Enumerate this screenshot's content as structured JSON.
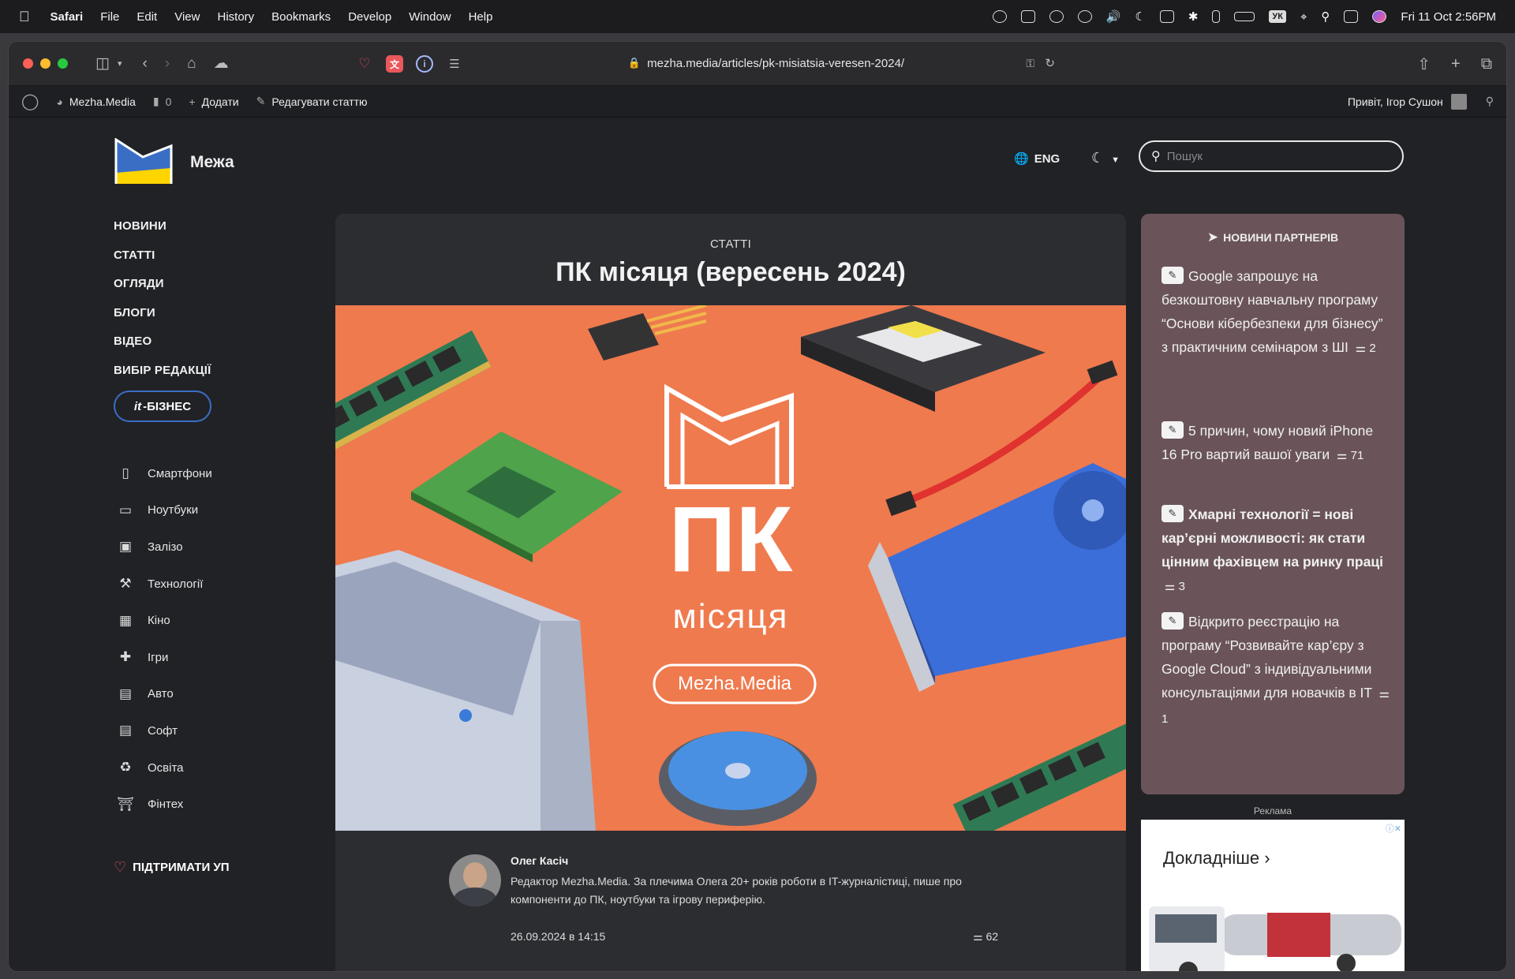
{
  "menubar": {
    "app": "Safari",
    "items": [
      "File",
      "Edit",
      "View",
      "History",
      "Bookmarks",
      "Develop",
      "Window",
      "Help"
    ],
    "vk": "УК",
    "clock": "Fri 11 Oct  2:56PM"
  },
  "browser": {
    "url": "mezha.media/articles/pk-misiatsia-veresen-2024/"
  },
  "wpbar": {
    "site": "Mezha.Media",
    "comments": "0",
    "add": "Додати",
    "edit": "Редагувати статтю",
    "greeting": "Привіт, Ігор Сушон"
  },
  "site": {
    "logo_text": "Межа",
    "nav": [
      "НОВИНИ",
      "СТАТТІ",
      "ОГЛЯДИ",
      "БЛОГИ",
      "ВІДЕО",
      "ВИБІР РЕДАКЦІЇ"
    ],
    "biz_prefix": "it",
    "biz_label": "-БІЗНЕС",
    "categories": [
      "Смартфони",
      "Ноутбуки",
      "Залізо",
      "Технології",
      "Кіно",
      "Ігри",
      "Авто",
      "Софт",
      "Освіта",
      "Фінтех"
    ],
    "support": "ПІДТРИМАТИ УП",
    "lang": "ENG",
    "search_placeholder": "Пошук"
  },
  "article": {
    "kicker": "СТАТТІ",
    "title": "ПК місяця (вересень 2024)",
    "hero_big": "ПК",
    "hero_small": "місяця",
    "hero_badge": "Mezha.Media",
    "author_name": "Олег Касіч",
    "author_bio": "Редактор Mezha.Media. За плечима Олега 20+ років роботи в IT-журналістиці, пише про компоненти до ПК, ноутбуки та ігрову периферію.",
    "date": "26.09.2024 в 14:15",
    "comments": "62"
  },
  "partners": {
    "heading": "НОВИНИ ПАРТНЕРІВ",
    "items": [
      {
        "text": "Google запрошує на безкоштовну навчальну програму “Основи кібербезпеки для бізнесу” з практичним семінаром з ШІ",
        "count": "2"
      },
      {
        "text": "5 причин, чому новий iPhone 16 Pro вартий вашої уваги",
        "count": "71"
      },
      {
        "text": "Хмарні технології = нові кар’єрні можливості: як стати цінним фахівцем на ринку праці",
        "count": "3"
      },
      {
        "text": "Відкрито реєстрацію на програму “Розвивайте кар’єру з Google Cloud” з індивідуальними консультаціями для новачків в IT",
        "count": "1"
      }
    ]
  },
  "ad": {
    "label": "Реклама",
    "cta": "Докладніше"
  },
  "colors": {
    "hero_bg": "#ef7a4e",
    "partners_bg": "#6a5459",
    "biz_border": "#3a6ec5"
  }
}
